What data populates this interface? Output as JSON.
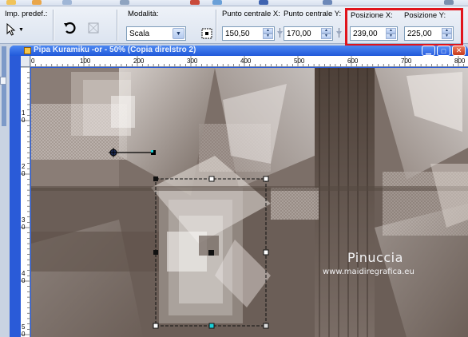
{
  "toolbar": {
    "preset_label": "Imp. predef.:",
    "mode_label": "Modalità:",
    "mode_value": "Scala",
    "center_x_label": "Punto centrale X:",
    "center_x_value": "150,50",
    "center_y_label": "Punto centrale Y:",
    "center_y_value": "170,00",
    "pos_x_label": "Posizione X:",
    "pos_x_value": "239,00",
    "pos_y_label": "Posizione Y:",
    "pos_y_value": "225,00"
  },
  "document": {
    "title": "Pipa Kuramiku -or - 50% (Copia direlstro 2)"
  },
  "rulers": {
    "h_ticks": [
      "0",
      "100",
      "200",
      "300",
      "400",
      "500",
      "600",
      "700",
      "800"
    ],
    "v_ticks": [
      "1",
      "2",
      "3",
      "4",
      "5"
    ],
    "v_sub": [
      "0",
      "0",
      "0",
      "0",
      "0"
    ]
  },
  "watermark": {
    "name": "Pinuccia",
    "site": "www.maidiregrafica.eu"
  },
  "colors": {
    "highlight": "#e0141c",
    "titlebar": "#2159d9",
    "canvas_dark": "#5e5249",
    "canvas_light": "#e6e0dc"
  },
  "icons": [
    "arrow-pointer-icon",
    "rotate-icon",
    "crop-square-icon",
    "pin-icon",
    "center-handle-icon"
  ]
}
